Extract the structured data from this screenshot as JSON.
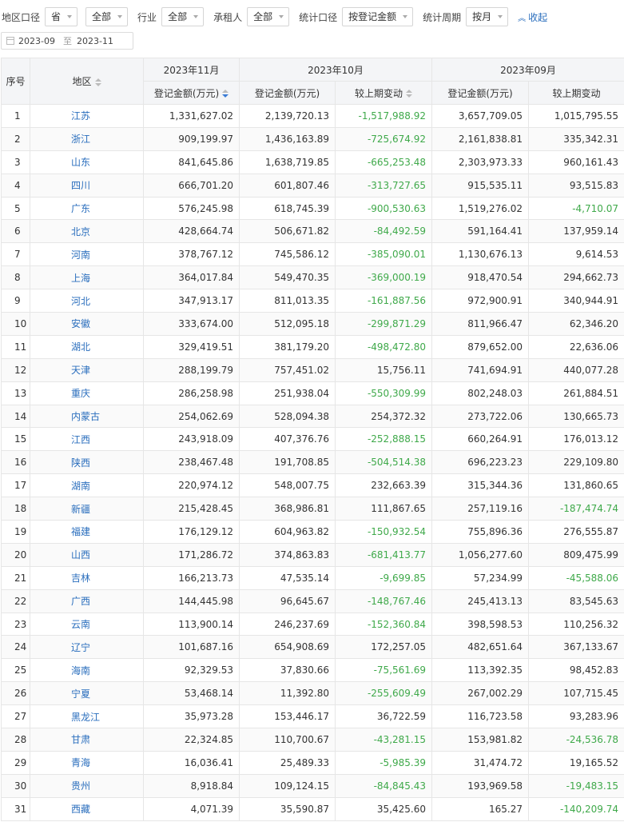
{
  "filters": {
    "region_scope_label": "地区口径",
    "region_scope_value": "省",
    "region_value": "全部",
    "industry_label": "行业",
    "industry_value": "全部",
    "lessee_label": "承租人",
    "lessee_value": "全部",
    "stat_scope_label": "统计口径",
    "stat_scope_value": "按登记金额",
    "stat_period_label": "统计周期",
    "stat_period_value": "按月",
    "collapse_label": "收起"
  },
  "date_range": {
    "start": "2023-09",
    "end": "2023-11",
    "separator": "至"
  },
  "table": {
    "col_index": "序号",
    "col_region": "地区",
    "months": [
      "2023年11月",
      "2023年10月",
      "2023年09月"
    ],
    "col_amount": "登记金额(万元)",
    "col_change": "较上期变动",
    "rows": [
      {
        "idx": "1",
        "region": "江苏",
        "nov": "1,331,627.02",
        "oct": "2,139,720.13",
        "oct_chg": "-1,517,988.92",
        "sep": "3,657,709.05",
        "sep_chg": "1,015,795.55"
      },
      {
        "idx": "2",
        "region": "浙江",
        "nov": "909,199.97",
        "oct": "1,436,163.89",
        "oct_chg": "-725,674.92",
        "sep": "2,161,838.81",
        "sep_chg": "335,342.31"
      },
      {
        "idx": "3",
        "region": "山东",
        "nov": "841,645.86",
        "oct": "1,638,719.85",
        "oct_chg": "-665,253.48",
        "sep": "2,303,973.33",
        "sep_chg": "960,161.43"
      },
      {
        "idx": "4",
        "region": "四川",
        "nov": "666,701.20",
        "oct": "601,807.46",
        "oct_chg": "-313,727.65",
        "sep": "915,535.11",
        "sep_chg": "93,515.83"
      },
      {
        "idx": "5",
        "region": "广东",
        "nov": "576,245.98",
        "oct": "618,745.39",
        "oct_chg": "-900,530.63",
        "sep": "1,519,276.02",
        "sep_chg": "-4,710.07"
      },
      {
        "idx": "6",
        "region": "北京",
        "nov": "428,664.74",
        "oct": "506,671.82",
        "oct_chg": "-84,492.59",
        "sep": "591,164.41",
        "sep_chg": "137,959.14"
      },
      {
        "idx": "7",
        "region": "河南",
        "nov": "378,767.12",
        "oct": "745,586.12",
        "oct_chg": "-385,090.01",
        "sep": "1,130,676.13",
        "sep_chg": "9,614.53"
      },
      {
        "idx": "8",
        "region": "上海",
        "nov": "364,017.84",
        "oct": "549,470.35",
        "oct_chg": "-369,000.19",
        "sep": "918,470.54",
        "sep_chg": "294,662.73"
      },
      {
        "idx": "9",
        "region": "河北",
        "nov": "347,913.17",
        "oct": "811,013.35",
        "oct_chg": "-161,887.56",
        "sep": "972,900.91",
        "sep_chg": "340,944.91"
      },
      {
        "idx": "10",
        "region": "安徽",
        "nov": "333,674.00",
        "oct": "512,095.18",
        "oct_chg": "-299,871.29",
        "sep": "811,966.47",
        "sep_chg": "62,346.20"
      },
      {
        "idx": "11",
        "region": "湖北",
        "nov": "329,419.51",
        "oct": "381,179.20",
        "oct_chg": "-498,472.80",
        "sep": "879,652.00",
        "sep_chg": "22,636.06"
      },
      {
        "idx": "12",
        "region": "天津",
        "nov": "288,199.79",
        "oct": "757,451.02",
        "oct_chg": "15,756.11",
        "sep": "741,694.91",
        "sep_chg": "440,077.28"
      },
      {
        "idx": "13",
        "region": "重庆",
        "nov": "286,258.98",
        "oct": "251,938.04",
        "oct_chg": "-550,309.99",
        "sep": "802,248.03",
        "sep_chg": "261,884.51"
      },
      {
        "idx": "14",
        "region": "内蒙古",
        "nov": "254,062.69",
        "oct": "528,094.38",
        "oct_chg": "254,372.32",
        "sep": "273,722.06",
        "sep_chg": "130,665.73"
      },
      {
        "idx": "15",
        "region": "江西",
        "nov": "243,918.09",
        "oct": "407,376.76",
        "oct_chg": "-252,888.15",
        "sep": "660,264.91",
        "sep_chg": "176,013.12"
      },
      {
        "idx": "16",
        "region": "陕西",
        "nov": "238,467.48",
        "oct": "191,708.85",
        "oct_chg": "-504,514.38",
        "sep": "696,223.23",
        "sep_chg": "229,109.80"
      },
      {
        "idx": "17",
        "region": "湖南",
        "nov": "220,974.12",
        "oct": "548,007.75",
        "oct_chg": "232,663.39",
        "sep": "315,344.36",
        "sep_chg": "131,860.65"
      },
      {
        "idx": "18",
        "region": "新疆",
        "nov": "215,428.45",
        "oct": "368,986.81",
        "oct_chg": "111,867.65",
        "sep": "257,119.16",
        "sep_chg": "-187,474.74"
      },
      {
        "idx": "19",
        "region": "福建",
        "nov": "176,129.12",
        "oct": "604,963.82",
        "oct_chg": "-150,932.54",
        "sep": "755,896.36",
        "sep_chg": "276,555.87"
      },
      {
        "idx": "20",
        "region": "山西",
        "nov": "171,286.72",
        "oct": "374,863.83",
        "oct_chg": "-681,413.77",
        "sep": "1,056,277.60",
        "sep_chg": "809,475.99"
      },
      {
        "idx": "21",
        "region": "吉林",
        "nov": "166,213.73",
        "oct": "47,535.14",
        "oct_chg": "-9,699.85",
        "sep": "57,234.99",
        "sep_chg": "-45,588.06"
      },
      {
        "idx": "22",
        "region": "广西",
        "nov": "144,445.98",
        "oct": "96,645.67",
        "oct_chg": "-148,767.46",
        "sep": "245,413.13",
        "sep_chg": "83,545.63"
      },
      {
        "idx": "23",
        "region": "云南",
        "nov": "113,900.14",
        "oct": "246,237.69",
        "oct_chg": "-152,360.84",
        "sep": "398,598.53",
        "sep_chg": "110,256.32"
      },
      {
        "idx": "24",
        "region": "辽宁",
        "nov": "101,687.16",
        "oct": "654,908.69",
        "oct_chg": "172,257.05",
        "sep": "482,651.64",
        "sep_chg": "367,133.67"
      },
      {
        "idx": "25",
        "region": "海南",
        "nov": "92,329.53",
        "oct": "37,830.66",
        "oct_chg": "-75,561.69",
        "sep": "113,392.35",
        "sep_chg": "98,452.83"
      },
      {
        "idx": "26",
        "region": "宁夏",
        "nov": "53,468.14",
        "oct": "11,392.80",
        "oct_chg": "-255,609.49",
        "sep": "267,002.29",
        "sep_chg": "107,715.45"
      },
      {
        "idx": "27",
        "region": "黑龙江",
        "nov": "35,973.28",
        "oct": "153,446.17",
        "oct_chg": "36,722.59",
        "sep": "116,723.58",
        "sep_chg": "93,283.96"
      },
      {
        "idx": "28",
        "region": "甘肃",
        "nov": "22,324.85",
        "oct": "110,700.67",
        "oct_chg": "-43,281.15",
        "sep": "153,981.82",
        "sep_chg": "-24,536.78"
      },
      {
        "idx": "29",
        "region": "青海",
        "nov": "16,036.41",
        "oct": "25,489.33",
        "oct_chg": "-5,985.39",
        "sep": "31,474.72",
        "sep_chg": "19,165.52"
      },
      {
        "idx": "30",
        "region": "贵州",
        "nov": "8,918.84",
        "oct": "109,124.15",
        "oct_chg": "-84,845.43",
        "sep": "193,969.58",
        "sep_chg": "-19,483.15"
      },
      {
        "idx": "31",
        "region": "西藏",
        "nov": "4,071.39",
        "oct": "35,590.87",
        "oct_chg": "35,425.60",
        "sep": "165.27",
        "sep_chg": "-140,209.74"
      }
    ]
  }
}
